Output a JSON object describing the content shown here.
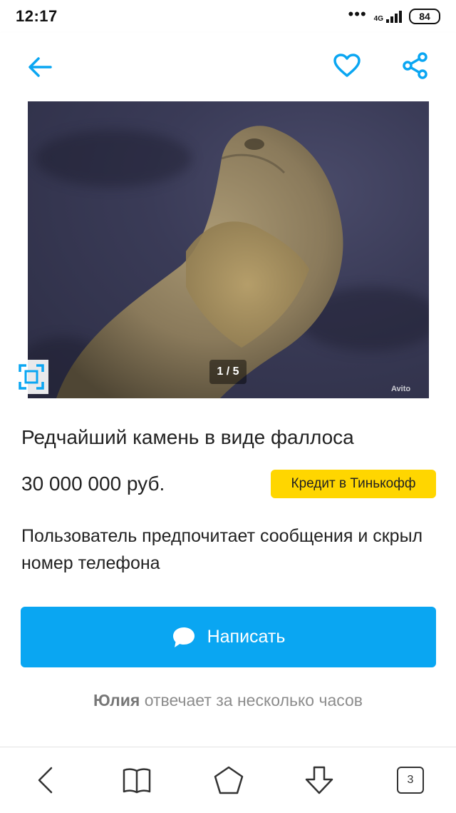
{
  "status_bar": {
    "time": "12:17",
    "network": "4G",
    "battery": "84"
  },
  "header": {
    "back_icon": "arrow-left-icon",
    "favorite_icon": "heart-icon",
    "share_icon": "share-icon"
  },
  "photo": {
    "counter": "1 / 5",
    "watermark": "Avito",
    "expand_icon": "expand-icon"
  },
  "listing": {
    "title": "Редчайший камень в виде фаллоса",
    "price": "30 000 000 руб.",
    "credit_label": "Кредит в Тинькофф",
    "contact_notice": "Пользователь предпочитает сообщения и скрыл номер телефона"
  },
  "contact": {
    "write_label": "Написать",
    "write_icon": "chat-bubble-icon"
  },
  "seller": {
    "name": "Юлия",
    "response_time": "отвечает за несколько часов"
  },
  "nav_bar": {
    "tabs_count": "3"
  },
  "colors": {
    "accent": "#0aa6f2",
    "credit": "#ffd600"
  }
}
